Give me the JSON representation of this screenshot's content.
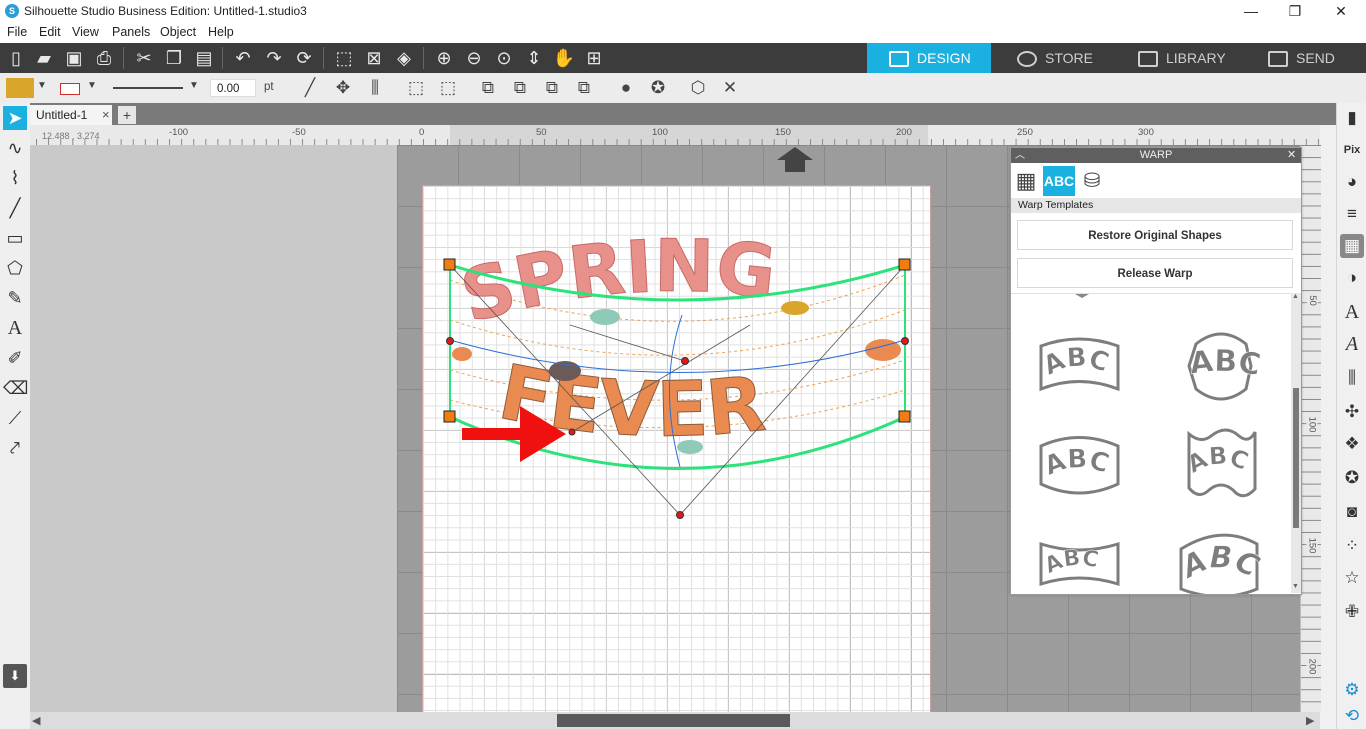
{
  "window": {
    "title": "Silhouette Studio Business Edition: Untitled-1.studio3",
    "app_icon": "S"
  },
  "window_controls": {
    "minimize": "—",
    "maximize": "❐",
    "close": "✕"
  },
  "menu": [
    "File",
    "Edit",
    "View",
    "Panels",
    "Object",
    "Help"
  ],
  "nav_tabs": {
    "design": "DESIGN",
    "store": "STORE",
    "library": "LIBRARY",
    "send": "SEND"
  },
  "colors": {
    "accent": "#1ab0e0",
    "toolbar_dark": "#3c3c3c",
    "fill_swatch": "#d9a62b",
    "line_swatch": "#d22c2c",
    "warp_green": "#2be37a",
    "handle_orange": "#f07c12"
  },
  "toolbar2": {
    "line_width": "0.00",
    "unit": "pt"
  },
  "document": {
    "tab_name": "Untitled-1",
    "close": "×",
    "new_tab": "+",
    "coords": "12.488 , 3.274"
  },
  "ruler": {
    "h": [
      "-100",
      "-50",
      "0",
      "50",
      "100",
      "150",
      "200",
      "250",
      "300"
    ],
    "v": [
      "50",
      "100",
      "150",
      "200"
    ]
  },
  "design": {
    "line1": "SPRING",
    "line2": "FEVER"
  },
  "warp_panel": {
    "title": "WARP",
    "close": "✕",
    "tab_abc": "ABC",
    "section": "Warp Templates",
    "restore_button": "Restore Original Shapes",
    "release_button": "Release Warp",
    "template_label": "ABC"
  }
}
